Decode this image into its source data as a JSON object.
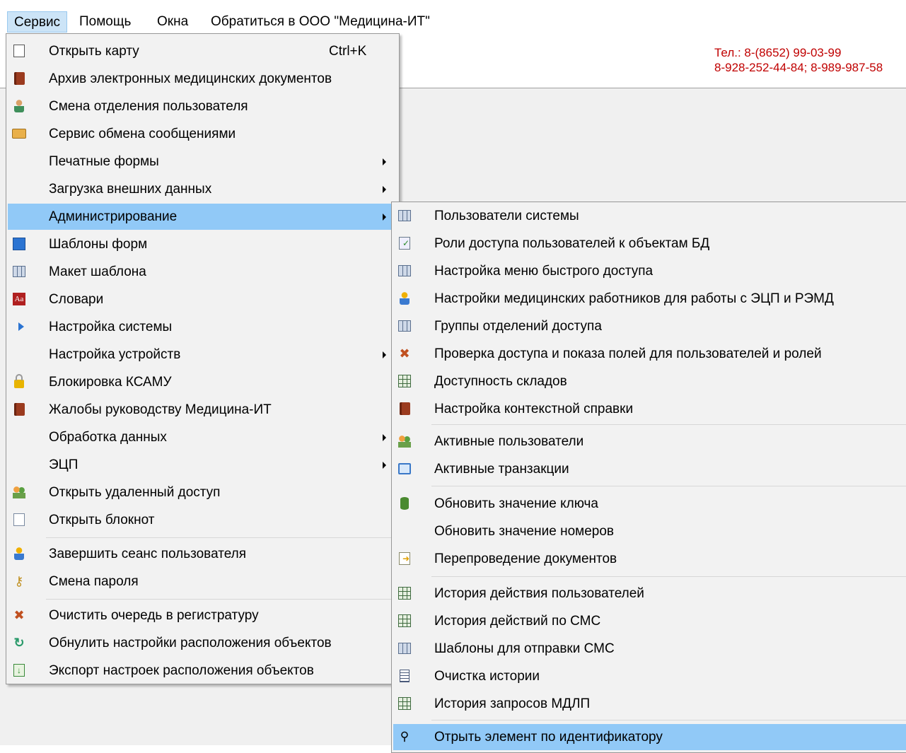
{
  "menubar": {
    "items": [
      {
        "label": "Сервис",
        "active": true
      },
      {
        "label": "Помощь"
      },
      {
        "label": "Окна"
      },
      {
        "label": "Обратиться в ООО \"Медицина-ИТ\""
      }
    ]
  },
  "header": {
    "phone_line1": "Тел.: 8-(8652) 99-03-99",
    "phone_line2": "8-928-252-44-84; 8-989-987-58"
  },
  "service_menu": {
    "items": [
      {
        "label": "Открыть карту",
        "shortcut": "Ctrl+K",
        "icon": "open-card-icon"
      },
      {
        "label": "Архив электронных медицинских документов",
        "icon": "book-icon"
      },
      {
        "label": "Смена отделения пользователя",
        "icon": "user-icon"
      },
      {
        "label": "Сервис обмена сообщениями",
        "icon": "mail-icon"
      },
      {
        "label": "Печатные формы",
        "submenu": true
      },
      {
        "label": "Загрузка внешних данных",
        "submenu": true
      },
      {
        "label": "Администрирование",
        "submenu": true,
        "highlighted": true
      },
      {
        "label": "Шаблоны форм",
        "icon": "image-icon"
      },
      {
        "label": "Макет шаблона",
        "icon": "grid-icon"
      },
      {
        "label": "Словари",
        "icon": "dictionary-icon"
      },
      {
        "label": "Настройка системы",
        "icon": "play-icon"
      },
      {
        "label": "Настройка устройств",
        "submenu": true
      },
      {
        "label": "Блокировка КСАМУ",
        "icon": "lock-icon"
      },
      {
        "label": "Жалобы руководству Медицина-ИТ",
        "icon": "book-icon"
      },
      {
        "label": "Обработка данных",
        "submenu": true
      },
      {
        "label": "ЭЦП",
        "submenu": true
      },
      {
        "label": "Открыть удаленный доступ",
        "icon": "people-icon"
      },
      {
        "label": "Открыть блокнот",
        "icon": "notepad-icon"
      },
      {
        "label": "Завершить сеанс пользователя",
        "icon": "user-logout-icon"
      },
      {
        "label": "Смена пароля",
        "icon": "key-icon"
      },
      {
        "label": "Очистить очередь в регистратуру",
        "icon": "tools-icon"
      },
      {
        "label": "Обнулить настройки расположения объектов",
        "icon": "refresh-icon"
      },
      {
        "label": "Экспорт настроек расположения объектов",
        "icon": "export-icon"
      }
    ]
  },
  "admin_menu": {
    "items": [
      {
        "label": "Пользователи системы",
        "icon": "grid-icon"
      },
      {
        "label": "Роли доступа пользователей к объектам БД",
        "icon": "doc-check-icon"
      },
      {
        "label": "Настройка меню быстрого доступа",
        "icon": "grid-icon"
      },
      {
        "label": "Настройки медицинских работников для работы с ЭЦП и РЭМД",
        "icon": "user-icon"
      },
      {
        "label": "Группы отделений доступа",
        "icon": "grid-icon"
      },
      {
        "label": "Проверка доступа и показа полей для пользователей и ролей",
        "icon": "tools-icon"
      },
      {
        "label": "Доступность складов",
        "icon": "table-icon"
      },
      {
        "label": "Настройка контекстной справки",
        "icon": "book-icon"
      },
      {
        "label": "Активные пользователи",
        "icon": "people-icon"
      },
      {
        "label": "Активные транзакции",
        "icon": "window-icon"
      },
      {
        "label": "Обновить значение ключа",
        "icon": "database-icon"
      },
      {
        "label": "Обновить значение номеров"
      },
      {
        "label": "Перепроведение документов",
        "icon": "doc-arrow-icon"
      },
      {
        "label": "История действия пользователей",
        "icon": "table-icon"
      },
      {
        "label": "История действий по СМС",
        "icon": "table-icon"
      },
      {
        "label": "Шаблоны для отправки СМС",
        "icon": "grid-icon"
      },
      {
        "label": "Очистка истории",
        "icon": "list-icon"
      },
      {
        "label": "История запросов МДЛП",
        "icon": "table-icon"
      },
      {
        "label": "Отрыть элемент по идентификатору",
        "icon": "search-icon",
        "highlighted": true
      }
    ]
  }
}
